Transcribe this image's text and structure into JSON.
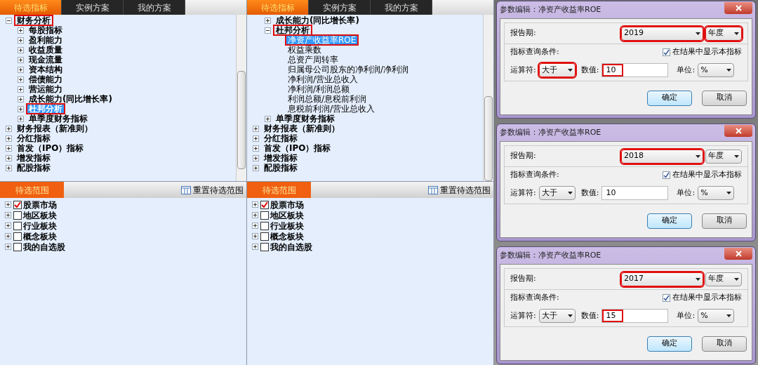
{
  "panels": [
    {
      "tabs": [
        {
          "label": "待选指标",
          "selected": true
        },
        {
          "label": "实例方案",
          "selected": false
        },
        {
          "label": "我的方案",
          "selected": false
        }
      ],
      "tree": [
        {
          "label": "财务分析",
          "kind": "folder",
          "expanded": true,
          "highlighted": true,
          "selected": false,
          "children": [
            {
              "label": "每股指标",
              "kind": "folder",
              "expanded": false,
              "highlighted": false,
              "selected": false
            },
            {
              "label": "盈利能力",
              "kind": "folder",
              "expanded": false,
              "highlighted": false,
              "selected": false
            },
            {
              "label": "收益质量",
              "kind": "folder",
              "expanded": false,
              "highlighted": false,
              "selected": false
            },
            {
              "label": "现金流量",
              "kind": "folder",
              "expanded": false,
              "highlighted": false,
              "selected": false
            },
            {
              "label": "资本结构",
              "kind": "folder",
              "expanded": false,
              "highlighted": false,
              "selected": false
            },
            {
              "label": "偿债能力",
              "kind": "folder",
              "expanded": false,
              "highlighted": false,
              "selected": false
            },
            {
              "label": "营运能力",
              "kind": "folder",
              "expanded": false,
              "highlighted": false,
              "selected": false
            },
            {
              "label": "成长能力(同比增长率)",
              "kind": "folder",
              "expanded": false,
              "highlighted": false,
              "selected": false
            },
            {
              "label": "杜邦分析",
              "kind": "folder",
              "expanded": false,
              "highlighted": true,
              "selected": true
            },
            {
              "label": "单季度财务指标",
              "kind": "folder",
              "expanded": false,
              "highlighted": false,
              "selected": false
            }
          ]
        },
        {
          "label": "财务报表（新准则）",
          "kind": "folder",
          "expanded": false,
          "highlighted": false,
          "selected": false
        },
        {
          "label": "分红指标",
          "kind": "folder",
          "expanded": false,
          "highlighted": false,
          "selected": false
        },
        {
          "label": "首发（IPO）指标",
          "kind": "folder",
          "expanded": false,
          "highlighted": false,
          "selected": false
        },
        {
          "label": "增发指标",
          "kind": "folder",
          "expanded": false,
          "highlighted": false,
          "selected": false
        },
        {
          "label": "配股指标",
          "kind": "folder",
          "expanded": false,
          "highlighted": false,
          "selected": false
        }
      ],
      "scope": {
        "tab": "待选范围",
        "reset_button": "重置待选范围",
        "items": [
          {
            "label": "股票市场",
            "checked": true
          },
          {
            "label": "地区板块",
            "checked": false
          },
          {
            "label": "行业板块",
            "checked": false
          },
          {
            "label": "概念板块",
            "checked": false
          },
          {
            "label": "我的自选股",
            "checked": false
          }
        ]
      }
    },
    {
      "tabs": [
        {
          "label": "待选指标",
          "selected": true
        },
        {
          "label": "实例方案",
          "selected": false
        },
        {
          "label": "我的方案",
          "selected": false
        }
      ],
      "tree": [
        {
          "children": [
            {
              "label": "成长能力(同比增长率)",
              "kind": "folder",
              "expanded": false,
              "highlighted": false,
              "selected": false
            },
            {
              "label": "杜邦分析",
              "kind": "folder",
              "expanded": true,
              "highlighted": true,
              "selected": false,
              "children": [
                {
                  "label": "净资产收益率ROE",
                  "kind": "leaf",
                  "highlighted": true,
                  "selected": true
                },
                {
                  "label": "权益乘数",
                  "kind": "leaf",
                  "highlighted": false,
                  "selected": false
                },
                {
                  "label": "总资产周转率",
                  "kind": "leaf",
                  "highlighted": false,
                  "selected": false
                },
                {
                  "label": "归属母公司股东的净利润/净利润",
                  "kind": "leaf",
                  "highlighted": false,
                  "selected": false
                },
                {
                  "label": "净利润/营业总收入",
                  "kind": "leaf",
                  "highlighted": false,
                  "selected": false
                },
                {
                  "label": "净利润/利润总额",
                  "kind": "leaf",
                  "highlighted": false,
                  "selected": false
                },
                {
                  "label": "利润总额/息税前利润",
                  "kind": "leaf",
                  "highlighted": false,
                  "selected": false
                },
                {
                  "label": "息税前利润/营业总收入",
                  "kind": "leaf",
                  "highlighted": false,
                  "selected": false
                }
              ]
            },
            {
              "label": "单季度财务指标",
              "kind": "folder",
              "expanded": false,
              "highlighted": false,
              "selected": false
            }
          ]
        },
        {
          "label": "财务报表（新准则）",
          "kind": "folder",
          "expanded": false,
          "highlighted": false,
          "selected": false
        },
        {
          "label": "分红指标",
          "kind": "folder",
          "expanded": false,
          "highlighted": false,
          "selected": false
        },
        {
          "label": "首发（IPO）指标",
          "kind": "folder",
          "expanded": false,
          "highlighted": false,
          "selected": false
        },
        {
          "label": "增发指标",
          "kind": "folder",
          "expanded": false,
          "highlighted": false,
          "selected": false
        },
        {
          "label": "配股指标",
          "kind": "folder",
          "expanded": false,
          "highlighted": false,
          "selected": false
        }
      ],
      "scope": {
        "tab": "待选范围",
        "reset_button": "重置待选范围",
        "items": [
          {
            "label": "股票市场",
            "checked": true
          },
          {
            "label": "地区板块",
            "checked": false
          },
          {
            "label": "行业板块",
            "checked": false
          },
          {
            "label": "概念板块",
            "checked": false
          },
          {
            "label": "我的自选股",
            "checked": false
          }
        ]
      }
    }
  ],
  "dialogs": [
    {
      "title": "参数编辑：净资产收益率ROE",
      "period_label": "报告期:",
      "year": "2019",
      "year_highlighted": true,
      "period_type": "年度",
      "period_type_highlighted": true,
      "condition_label": "指标查询条件:",
      "show_in_result": {
        "label": "在结果中显示本指标",
        "checked": true
      },
      "operator_label": "运算符:",
      "operator": "大于",
      "operator_highlighted": true,
      "value_label": "数值:",
      "value": "10",
      "value_highlighted": true,
      "unit_label": "单位:",
      "unit": "%",
      "ok": "确定",
      "cancel": "取消"
    },
    {
      "title": "参数编辑：净资产收益率ROE",
      "period_label": "报告期:",
      "year": "2018",
      "year_highlighted": true,
      "period_type": "年度",
      "period_type_highlighted": false,
      "condition_label": "指标查询条件:",
      "show_in_result": {
        "label": "在结果中显示本指标",
        "checked": true
      },
      "operator_label": "运算符:",
      "operator": "大于",
      "operator_highlighted": false,
      "value_label": "数值:",
      "value": "10",
      "value_highlighted": false,
      "unit_label": "单位:",
      "unit": "%",
      "ok": "确定",
      "cancel": "取消"
    },
    {
      "title": "参数编辑：净资产收益率ROE",
      "period_label": "报告期:",
      "year": "2017",
      "year_highlighted": true,
      "period_type": "年度",
      "period_type_highlighted": false,
      "condition_label": "指标查询条件:",
      "show_in_result": {
        "label": "在结果中显示本指标",
        "checked": true
      },
      "operator_label": "运算符:",
      "operator": "大于",
      "operator_highlighted": false,
      "value_label": "数值:",
      "value": "15",
      "value_highlighted": true,
      "unit_label": "单位:",
      "unit": "%",
      "ok": "确定",
      "cancel": "取消"
    }
  ]
}
